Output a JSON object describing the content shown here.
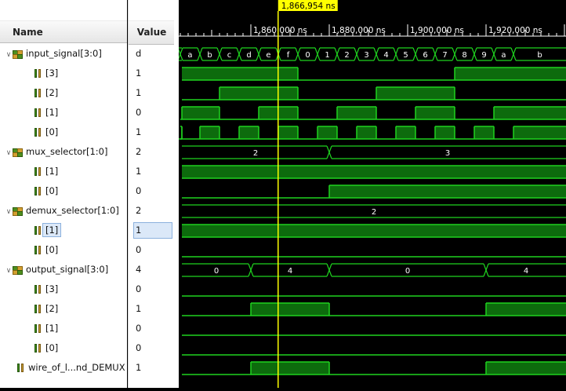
{
  "columns": {
    "name": "Name",
    "value": "Value"
  },
  "cursor": {
    "label": "1,866,954 ns"
  },
  "time_ticks": [
    "1,860,000 ns",
    "1,880,000 ns",
    "1,900,000 ns",
    "1,920,000 ns"
  ],
  "signals": [
    {
      "name": "input_signal[3:0]",
      "value": "d"
    },
    {
      "name": "[3]",
      "value": "1"
    },
    {
      "name": "[2]",
      "value": "1"
    },
    {
      "name": "[1]",
      "value": "0"
    },
    {
      "name": "[0]",
      "value": "1"
    },
    {
      "name": "mux_selector[1:0]",
      "value": "2"
    },
    {
      "name": "[1]",
      "value": "1"
    },
    {
      "name": "[0]",
      "value": "0"
    },
    {
      "name": "demux_selector[1:0]",
      "value": "2"
    },
    {
      "name": "[1]",
      "value": "1"
    },
    {
      "name": "[0]",
      "value": "0"
    },
    {
      "name": "output_signal[3:0]",
      "value": "4"
    },
    {
      "name": "[3]",
      "value": "0"
    },
    {
      "name": "[2]",
      "value": "1"
    },
    {
      "name": "[1]",
      "value": "0"
    },
    {
      "name": "[0]",
      "value": "0"
    },
    {
      "name": "wire_of_l...nd_DEMUX",
      "value": "1"
    }
  ],
  "bus_values": {
    "input_signal": [
      "8",
      "9",
      "a",
      "b",
      "c",
      "d",
      "e",
      "f",
      "0",
      "1",
      "2",
      "3",
      "4",
      "5",
      "6",
      "7",
      "8",
      "9",
      "a",
      "b"
    ],
    "mux_selector": [
      "2",
      "3"
    ],
    "demux_selector": [
      "2"
    ],
    "output_signal": [
      "0",
      "4",
      "0",
      "4"
    ]
  },
  "colors": {
    "wave": "#1fd21f",
    "fill": "#0d6b0d",
    "cursor": "#ffff00"
  }
}
